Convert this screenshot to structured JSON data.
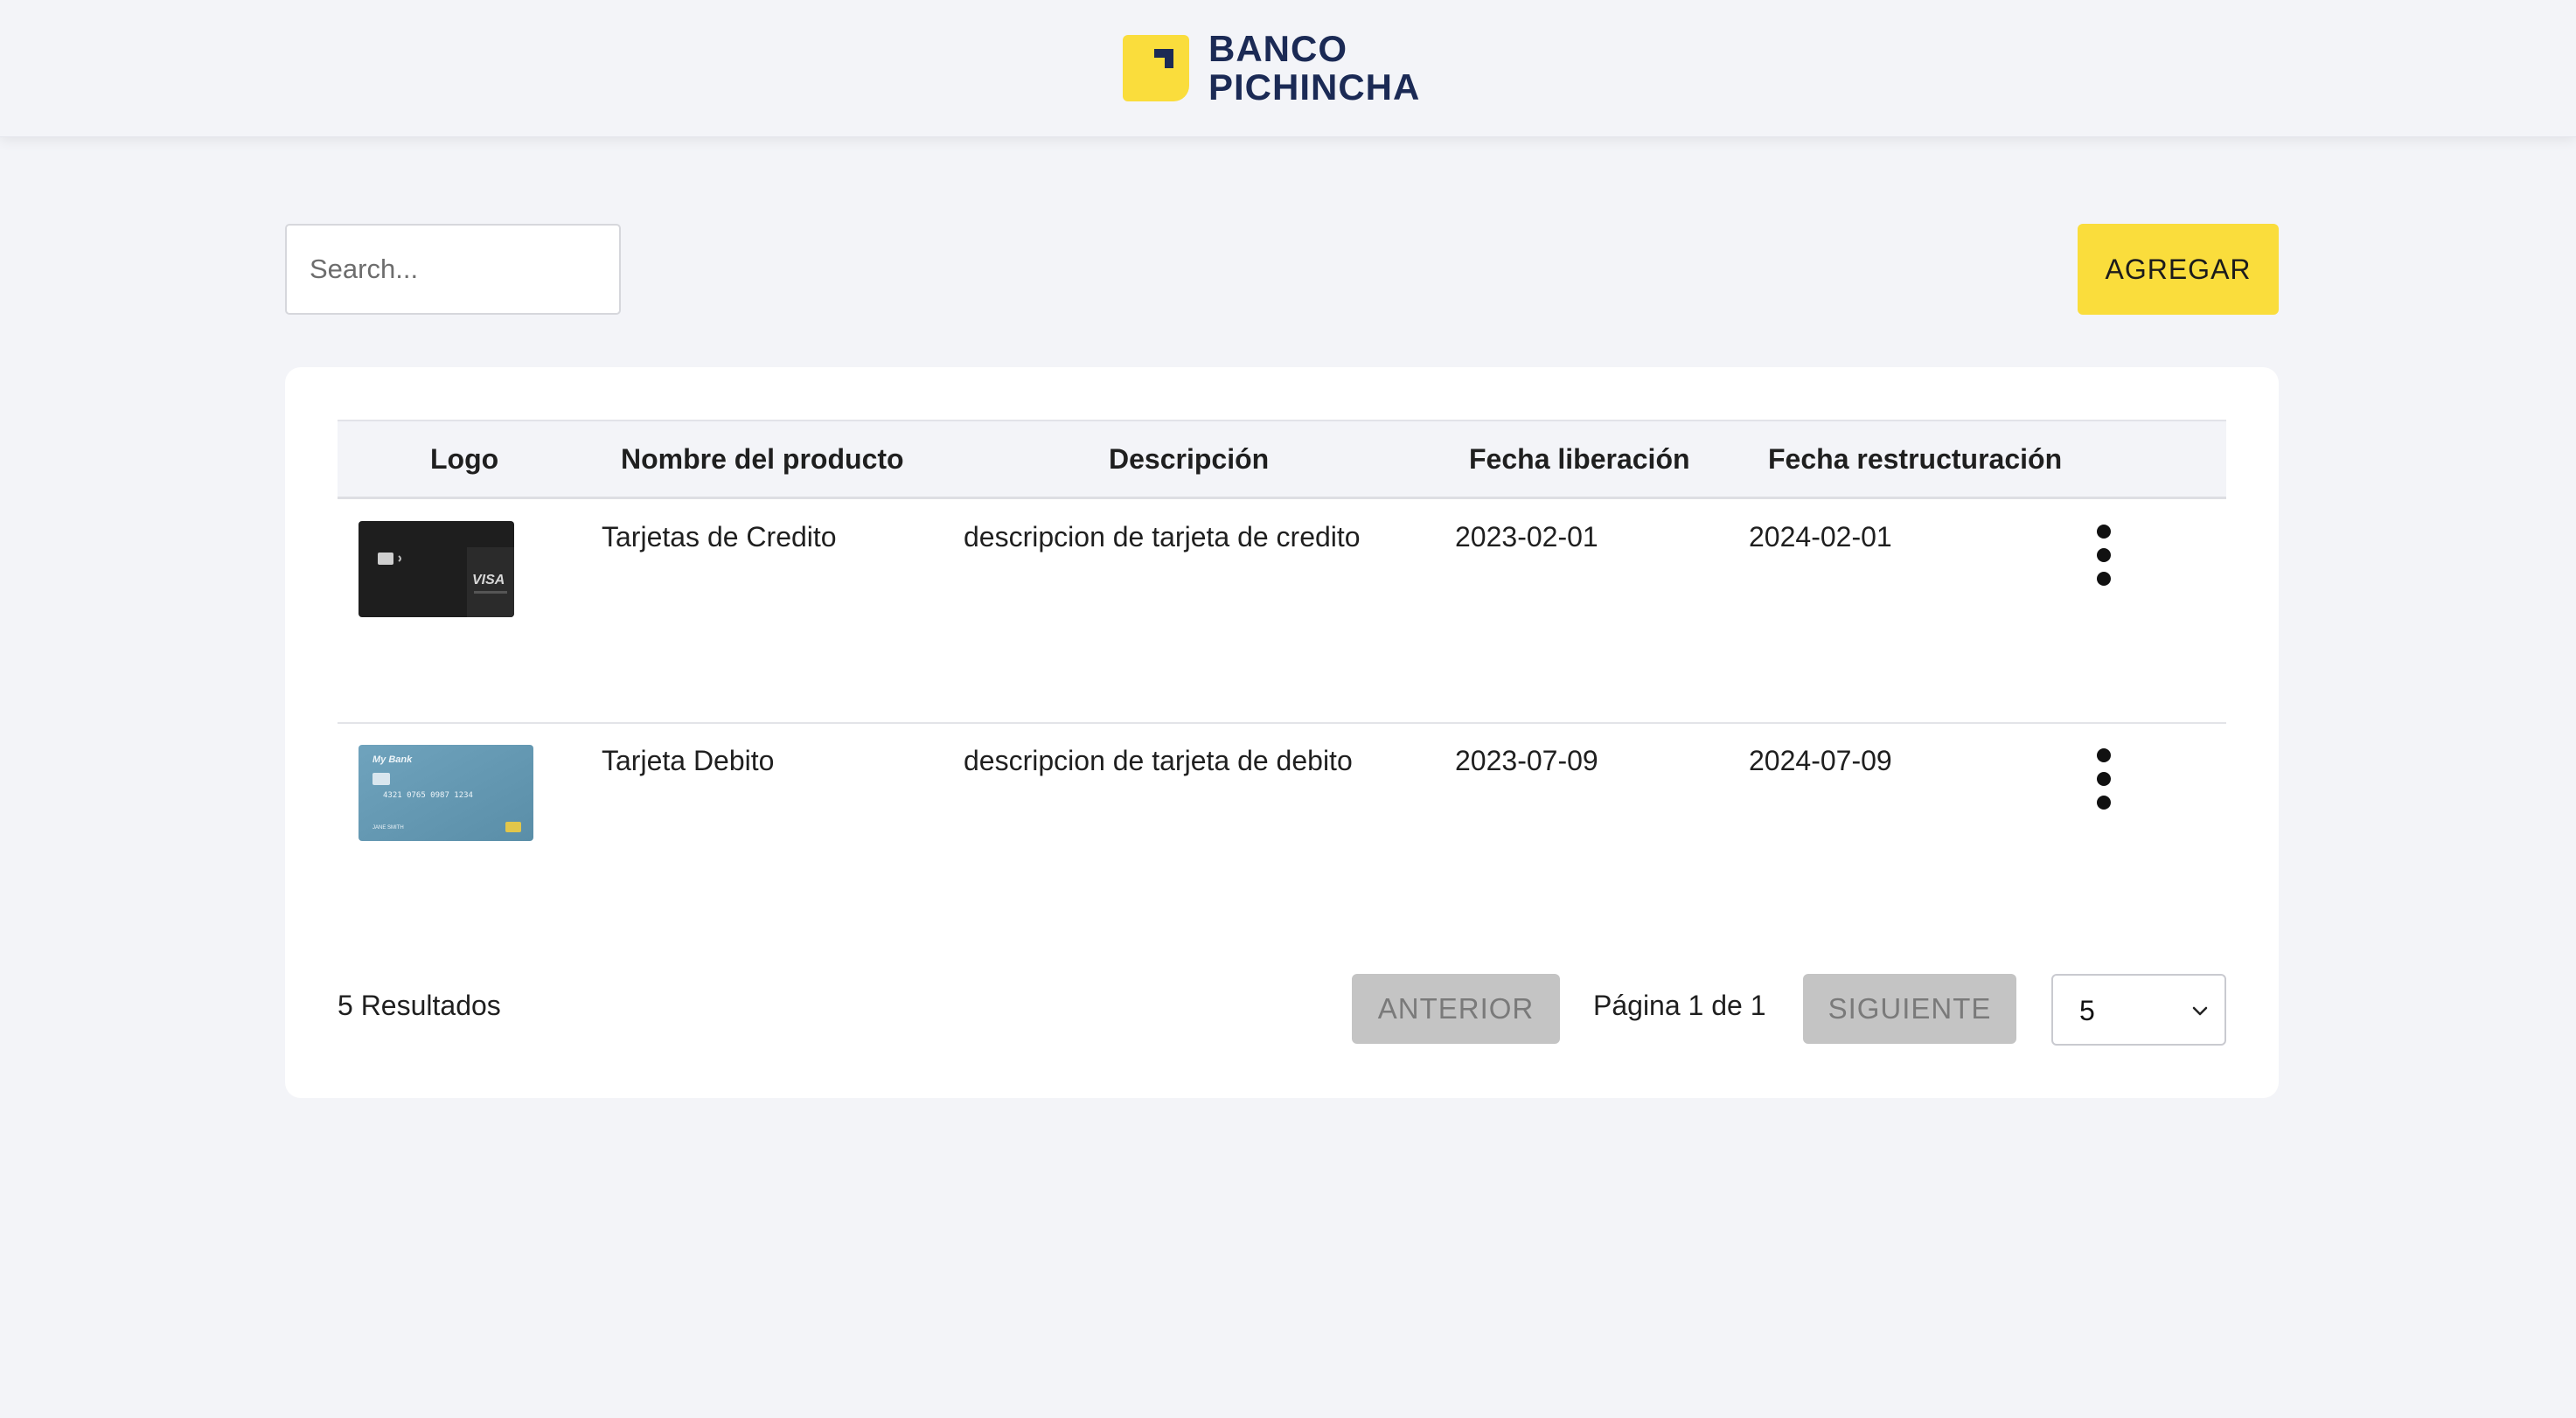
{
  "brand": {
    "line1": "BANCO",
    "line2": "PICHINCHA",
    "logo_color": "#fadd3c",
    "text_color": "#1b2a55"
  },
  "search": {
    "placeholder": "Search...",
    "value": ""
  },
  "toolbar": {
    "add_label": "AGREGAR",
    "add_color": "#fadd3c"
  },
  "table": {
    "headers": [
      "Logo",
      "Nombre del producto",
      "Descripción",
      "Fecha liberación",
      "Fecha restructuración"
    ],
    "rows": [
      {
        "logo": "visa-black-card-image",
        "name": "Tarjetas de Credito",
        "description": "descripcion de tarjeta de credito",
        "release_date": "2023-02-01",
        "restructure_date": "2024-02-01",
        "menu_icon": "kebab-menu-icon"
      },
      {
        "logo": "blue-bank-card-image",
        "name": "Tarjeta Debito",
        "description": "descripcion de tarjeta de debito",
        "release_date": "2023-07-09",
        "restructure_date": "2024-07-09",
        "menu_icon": "kebab-menu-icon"
      }
    ]
  },
  "footer": {
    "results": "5 Resultados",
    "prev_label": "ANTERIOR",
    "page_info": "Página 1 de 1",
    "next_label": "SIGUIENTE",
    "page_size": "5"
  }
}
